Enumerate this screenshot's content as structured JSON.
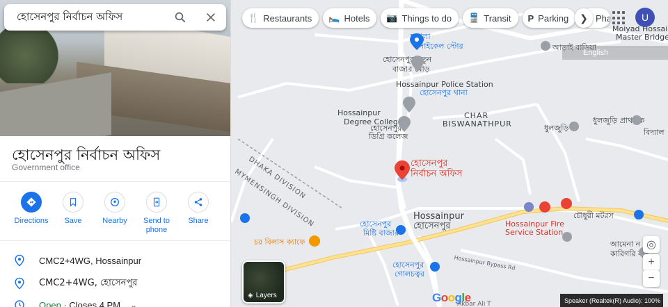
{
  "search": {
    "query": "হোসেনপুর নির্বাচন অফিস"
  },
  "place": {
    "title": "হোসেনপুর নির্বাচন অফিস",
    "category": "Government office",
    "actions": [
      {
        "label": "Directions",
        "icon": "directions-icon"
      },
      {
        "label": "Save",
        "icon": "bookmark-icon"
      },
      {
        "label": "Nearby",
        "icon": "nearby-icon"
      },
      {
        "label": "Send to\nphone",
        "icon": "send-to-phone-icon"
      },
      {
        "label": "Share",
        "icon": "share-icon"
      }
    ],
    "plus_code": "CMC2+4WG, Hossainpur",
    "plus_code_local": "CMC2+4WG, হোসেনপুর",
    "hours_status": "Open",
    "hours_detail": " · Closes 4 PM"
  },
  "chips": [
    "Restaurants",
    "Hotels",
    "Things to do",
    "Transit",
    "Parking",
    "Pha"
  ],
  "account": {
    "initial": "U"
  },
  "language": "English",
  "layers_label": "Layers",
  "speaker_text": "Speaker (Realtek(R) Audio): 100%",
  "map_labels": {
    "shapla_1": "শাপলা",
    "shapla_2": "সাইকেল স্টোর",
    "natun_1": "হোসেনপুর নতুন",
    "natun_2": "বাজার মোড়",
    "police_1": "Hossainpur Police Station",
    "police_2": "হোসেনপুর থানা",
    "college_1": "Hossainpur",
    "college_2": "Degree College",
    "college_3": "হোসেনপুর",
    "college_4": "ডিগ্রি কলেজ",
    "char_1": "CHAR",
    "char_2": "BISWANATHPUR",
    "target_1": "হোসেনপুর",
    "target_2": "নির্বাচন অফিস",
    "dhaka": "DHAKA DIVISION",
    "mymensingh": "MYMENSINGH DIVISION",
    "hossainpur_en": "Hossainpur",
    "hossainpur_bn": "হোসেনপুর",
    "mishti_1": "হোসেনপুর",
    "mishti_2": "মিষ্টি বাজার",
    "cafe": "চর বিলাস ক্যাফে",
    "golchattar_1": "হোসেনপুর",
    "golchattar_2": "গোলচত্বর",
    "fire_1": "Hossainpur Fire",
    "fire_2": "Service Station",
    "chowdhury": "চৌধুরী মটরস",
    "moiyad_1": "Moiyad Hossain",
    "moiyad_2": "Master Bridge",
    "aurai": "আড়াই বাড়িয়া",
    "dhulaguri_1": "ধুলজুড়ি প্রাথমিক",
    "dhulaguri_2": "বিদ্যাল",
    "dhulaguri_3": "ধুলজুড়ি",
    "amena_1": "আমেনা ন",
    "amena_2": "কারিগরি স্",
    "bypass": "Hossainpur Bypass Rd",
    "akbar": "Akbar Ali T"
  }
}
